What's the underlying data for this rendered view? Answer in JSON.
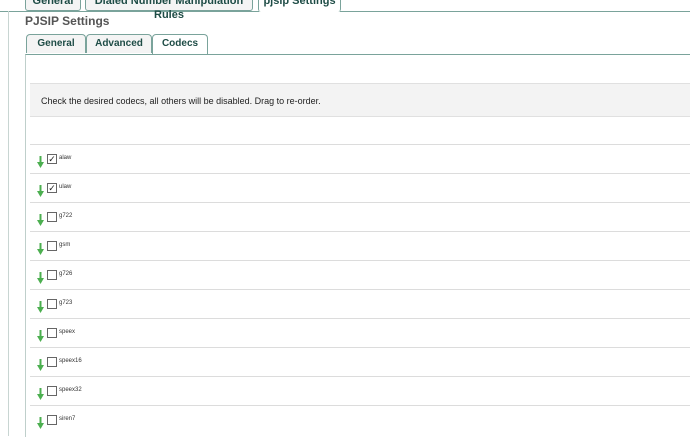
{
  "top_tabs": [
    "General",
    "Dialed Number Manipulation Rules",
    "pjsip Settings"
  ],
  "page_title": "PJSIP Settings",
  "subtabs": [
    "General",
    "Advanced",
    "Codecs"
  ],
  "info_text": "Check the desired codecs, all others will be disabled. Drag to re-order.",
  "codecs": [
    {
      "name": "alaw",
      "checked": true
    },
    {
      "name": "ulaw",
      "checked": true
    },
    {
      "name": "g722",
      "checked": false
    },
    {
      "name": "gsm",
      "checked": false
    },
    {
      "name": "g726",
      "checked": false
    },
    {
      "name": "g723",
      "checked": false
    },
    {
      "name": "speex",
      "checked": false
    },
    {
      "name": "speex16",
      "checked": false
    },
    {
      "name": "speex32",
      "checked": false
    },
    {
      "name": "siren7",
      "checked": false
    }
  ],
  "icons": {
    "drag": "drag-arrow-icon",
    "check_mark": "✓"
  },
  "colors": {
    "accent": "#1e4c46",
    "tab_border": "#7aa39b",
    "drag_arrow": "#4caf50"
  }
}
